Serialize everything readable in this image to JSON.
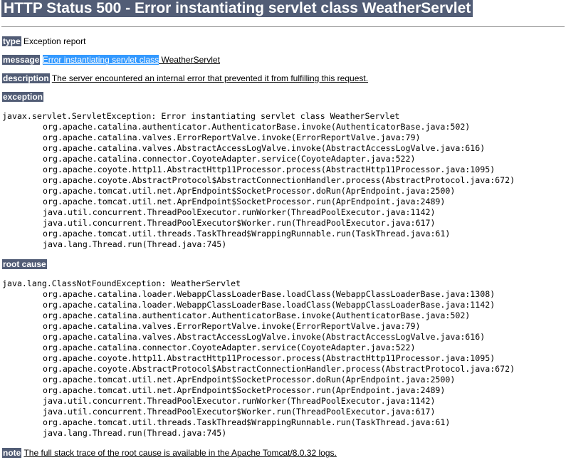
{
  "page": {
    "title": "HTTP Status 500 - Error instantiating servlet class WeatherServlet"
  },
  "fields": {
    "type_label": "type",
    "type_value": "Exception report",
    "message_label": "message",
    "message_highlighted": "Error instantiating servlet class",
    "message_rest": " WeatherServlet",
    "description_label": "description",
    "description_value": "The server encountered an internal error that prevented it from fulfilling this request.",
    "exception_label": "exception",
    "root_cause_label": "root cause",
    "note_label": "note",
    "note_value": "The full stack trace of the root cause is available in the Apache Tomcat/8.0.32 logs."
  },
  "exception_trace": [
    "javax.servlet.ServletException: Error instantiating servlet class WeatherServlet",
    "org.apache.catalina.authenticator.AuthenticatorBase.invoke(AuthenticatorBase.java:502)",
    "org.apache.catalina.valves.ErrorReportValve.invoke(ErrorReportValve.java:79)",
    "org.apache.catalina.valves.AbstractAccessLogValve.invoke(AbstractAccessLogValve.java:616)",
    "org.apache.catalina.connector.CoyoteAdapter.service(CoyoteAdapter.java:522)",
    "org.apache.coyote.http11.AbstractHttp11Processor.process(AbstractHttp11Processor.java:1095)",
    "org.apache.coyote.AbstractProtocol$AbstractConnectionHandler.process(AbstractProtocol.java:672)",
    "org.apache.tomcat.util.net.AprEndpoint$SocketProcessor.doRun(AprEndpoint.java:2500)",
    "org.apache.tomcat.util.net.AprEndpoint$SocketProcessor.run(AprEndpoint.java:2489)",
    "java.util.concurrent.ThreadPoolExecutor.runWorker(ThreadPoolExecutor.java:1142)",
    "java.util.concurrent.ThreadPoolExecutor$Worker.run(ThreadPoolExecutor.java:617)",
    "org.apache.tomcat.util.threads.TaskThread$WrappingRunnable.run(TaskThread.java:61)",
    "java.lang.Thread.run(Thread.java:745)"
  ],
  "root_cause_trace": [
    "java.lang.ClassNotFoundException: WeatherServlet",
    "org.apache.catalina.loader.WebappClassLoaderBase.loadClass(WebappClassLoaderBase.java:1308)",
    "org.apache.catalina.loader.WebappClassLoaderBase.loadClass(WebappClassLoaderBase.java:1142)",
    "org.apache.catalina.authenticator.AuthenticatorBase.invoke(AuthenticatorBase.java:502)",
    "org.apache.catalina.valves.ErrorReportValve.invoke(ErrorReportValve.java:79)",
    "org.apache.catalina.valves.AbstractAccessLogValve.invoke(AbstractAccessLogValve.java:616)",
    "org.apache.catalina.connector.CoyoteAdapter.service(CoyoteAdapter.java:522)",
    "org.apache.coyote.http11.AbstractHttp11Processor.process(AbstractHttp11Processor.java:1095)",
    "org.apache.coyote.AbstractProtocol$AbstractConnectionHandler.process(AbstractProtocol.java:672)",
    "org.apache.tomcat.util.net.AprEndpoint$SocketProcessor.doRun(AprEndpoint.java:2500)",
    "org.apache.tomcat.util.net.AprEndpoint$SocketProcessor.run(AprEndpoint.java:2489)",
    "java.util.concurrent.ThreadPoolExecutor.runWorker(ThreadPoolExecutor.java:1142)",
    "java.util.concurrent.ThreadPoolExecutor$Worker.run(ThreadPoolExecutor.java:617)",
    "org.apache.tomcat.util.threads.TaskThread$WrappingRunnable.run(TaskThread.java:61)",
    "java.lang.Thread.run(Thread.java:745)"
  ],
  "colors": {
    "label_background": "#525D76",
    "label_text": "#ffffff",
    "selection_highlight": "#3399ff"
  }
}
